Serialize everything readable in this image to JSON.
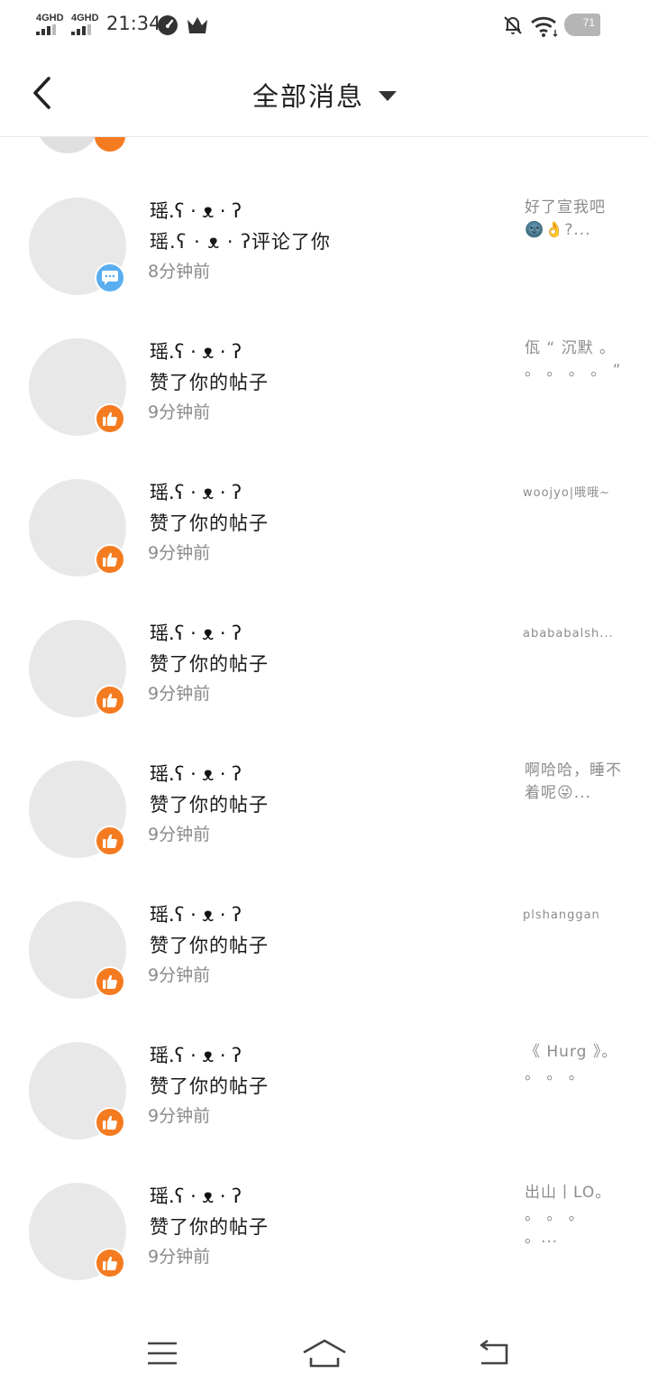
{
  "status_bar": {
    "network_1": "4GHD",
    "network_2": "4GHD",
    "time": "21:34",
    "battery": "71",
    "icons": [
      "signal-icon",
      "signal-icon",
      "speedometer-icon",
      "crown-icon",
      "bell-off-icon",
      "wifi-icon",
      "battery-icon"
    ]
  },
  "header": {
    "title": "全部消息",
    "back_icon": "chevron-left-icon",
    "dropdown_icon": "caret-down-icon"
  },
  "messages": [
    {
      "nickname": "瑶.ʕ · ᴥ · ʔ",
      "action": "瑶.ʕ · ᴥ · ʔ评论了你",
      "time": "8分钟前",
      "preview": "好了宣我吧🌚👌?...",
      "type": "comment"
    },
    {
      "nickname": "瑶.ʕ · ᴥ · ʔ",
      "action": "赞了你的帖子",
      "time": "9分钟前",
      "preview": "佤 “ 沉默 。 。 。 。 。 ”",
      "type": "like"
    },
    {
      "nickname": "瑶.ʕ · ᴥ · ʔ",
      "action": "赞了你的帖子",
      "time": "9分钟前",
      "preview": "woojyo|哦哦~",
      "type": "like"
    },
    {
      "nickname": "瑶.ʕ · ᴥ · ʔ",
      "action": "赞了你的帖子",
      "time": "9分钟前",
      "preview": "abababalsh...",
      "type": "like"
    },
    {
      "nickname": "瑶.ʕ · ᴥ · ʔ",
      "action": "赞了你的帖子",
      "time": "9分钟前",
      "preview": "啊哈哈，睡不着呢😜...",
      "type": "like"
    },
    {
      "nickname": "瑶.ʕ · ᴥ · ʔ",
      "action": "赞了你的帖子",
      "time": "9分钟前",
      "preview": "plshanggan",
      "type": "like"
    },
    {
      "nickname": "瑶.ʕ · ᴥ · ʔ",
      "action": "赞了你的帖子",
      "time": "9分钟前",
      "preview": "《 Hurg 》。 。 。 。",
      "type": "like"
    },
    {
      "nickname": "瑶.ʕ · ᴥ · ʔ",
      "action": "赞了你的帖子",
      "time": "9分钟前",
      "preview": "出山丨LO。 。 。 。 。...",
      "type": "like"
    }
  ],
  "bottom_nav": {
    "icons": [
      "menu-icon",
      "home-icon",
      "return-icon"
    ]
  },
  "colors": {
    "like_badge": "#f47b20",
    "comment_badge": "#5aaef0",
    "avatar_placeholder": "#e8e8e8",
    "divider": "#e6e6e6"
  }
}
